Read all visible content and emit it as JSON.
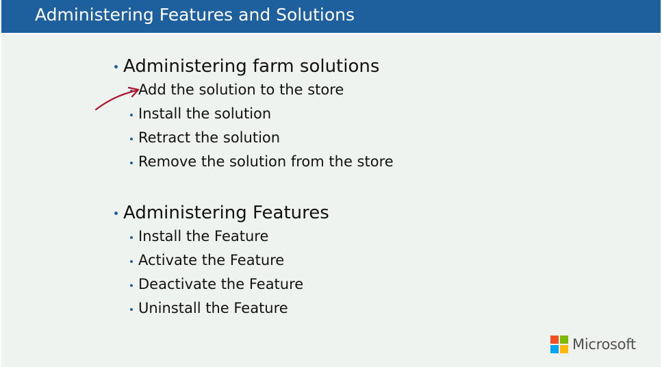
{
  "slide": {
    "title": "Administering Features and Solutions",
    "sections": [
      {
        "heading": "Administering farm solutions",
        "items": [
          "Add the solution to the store",
          "Install the solution",
          "Retract the solution",
          "Remove the solution from the store"
        ]
      },
      {
        "heading": "Administering Features",
        "items": [
          "Install the Feature",
          "Activate the Feature",
          "Deactivate the Feature",
          "Uninstall the Feature"
        ]
      }
    ],
    "logo_text": "Microsoft"
  },
  "colors": {
    "title_bar": "#1e5f9e",
    "background": "#eff3ef",
    "bullet": "#1e5f9e",
    "pen_annotation": "#b0102a"
  },
  "icons": {
    "logo": "microsoft-logo-icon",
    "annotation": "hand-drawn-arrow-icon"
  }
}
